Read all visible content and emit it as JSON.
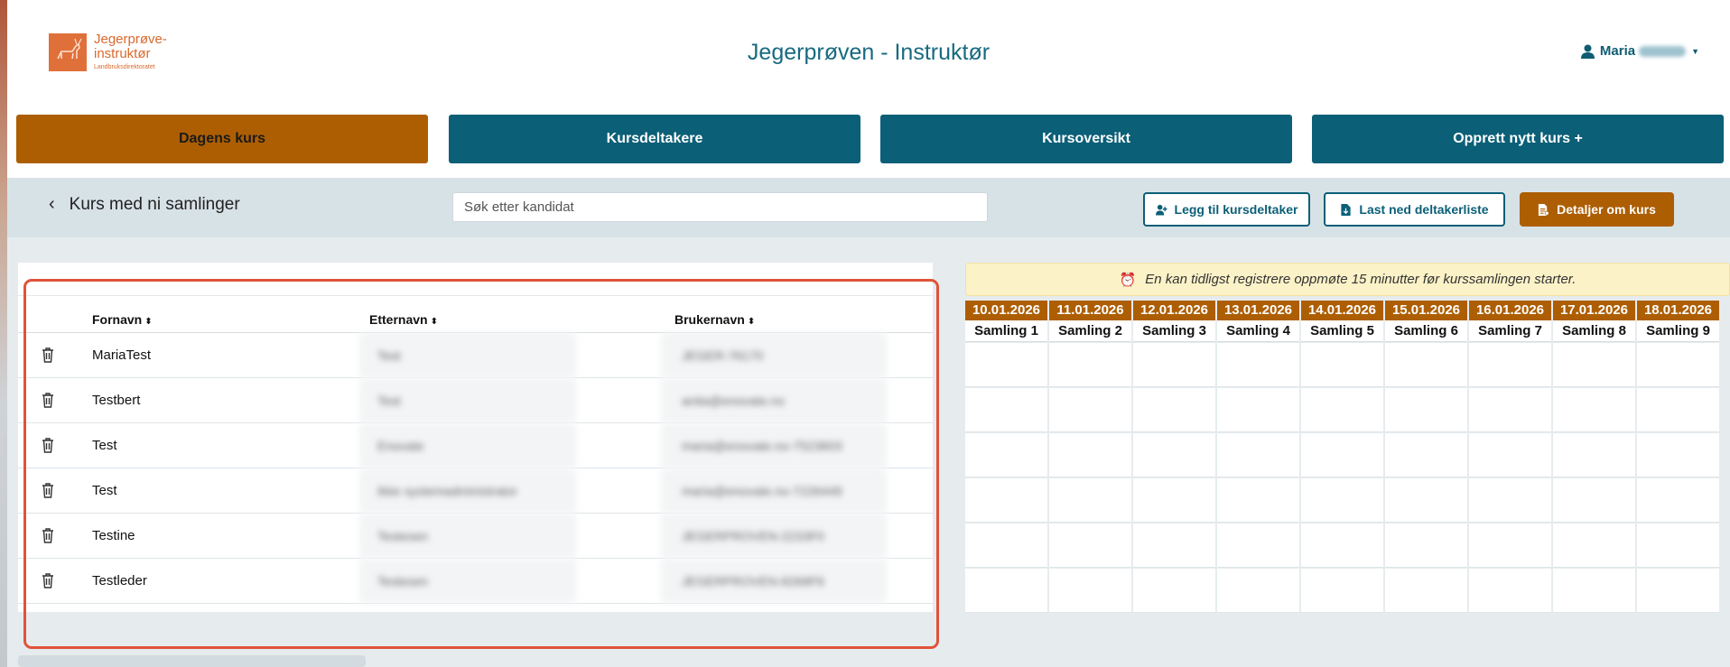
{
  "header": {
    "logo": {
      "line1": "Jegerprøve-",
      "line2": "instruktør",
      "sub": "Landbruksdirektoratet"
    },
    "title": "Jegerprøven - Instruktør",
    "user": {
      "name": "Maria",
      "icon": "user-icon"
    }
  },
  "nav": {
    "tabs": [
      {
        "label": "Dagens kurs",
        "active": true
      },
      {
        "label": "Kursdeltakere",
        "active": false
      },
      {
        "label": "Kursoversikt",
        "active": false
      },
      {
        "label": "Opprett nytt kurs +",
        "active": false
      }
    ]
  },
  "toolbar": {
    "course_title": "Kurs med ni samlinger",
    "search_placeholder": "Søk etter kandidat",
    "add_participant": "Legg til kursdeltaker",
    "download_list": "Last ned deltakerliste",
    "course_details": "Detaljer om kurs"
  },
  "table": {
    "columns": [
      "Fornavn",
      "Etternavn",
      "Brukernavn"
    ],
    "rows": [
      {
        "first": "MariaTest",
        "last": "Test",
        "username": "JEGER-76170"
      },
      {
        "first": "Testbert",
        "last": "Test",
        "username": "anita@enovate.no"
      },
      {
        "first": "Test",
        "last": "Enovate",
        "username": "maria@enovate.no-7523803"
      },
      {
        "first": "Test",
        "last": "Ikke systemadministrator",
        "username": "maria@enovate.no-7226449"
      },
      {
        "first": "Testine",
        "last": "Testesen",
        "username": "JEGERPROVEN-2233F0"
      },
      {
        "first": "Testleder",
        "last": "Testesen",
        "username": "JEGERPROVEN-8268F6"
      }
    ]
  },
  "schedule": {
    "notice": "En kan tidligst registrere oppmøte 15 minutter før kurssamlingen starter.",
    "dates": [
      "10.01.2026",
      "11.01.2026",
      "12.01.2026",
      "13.01.2026",
      "14.01.2026",
      "15.01.2026",
      "16.01.2026",
      "17.01.2026",
      "18.01.2026"
    ],
    "sessions": [
      "Samling 1",
      "Samling 2",
      "Samling 3",
      "Samling 4",
      "Samling 5",
      "Samling 6",
      "Samling 7",
      "Samling 8",
      "Samling 9"
    ]
  },
  "colors": {
    "teal": "#0b5f77",
    "brown": "#ad5e03",
    "highlight": "#e0533a",
    "notice_bg": "#fcf2c8"
  }
}
